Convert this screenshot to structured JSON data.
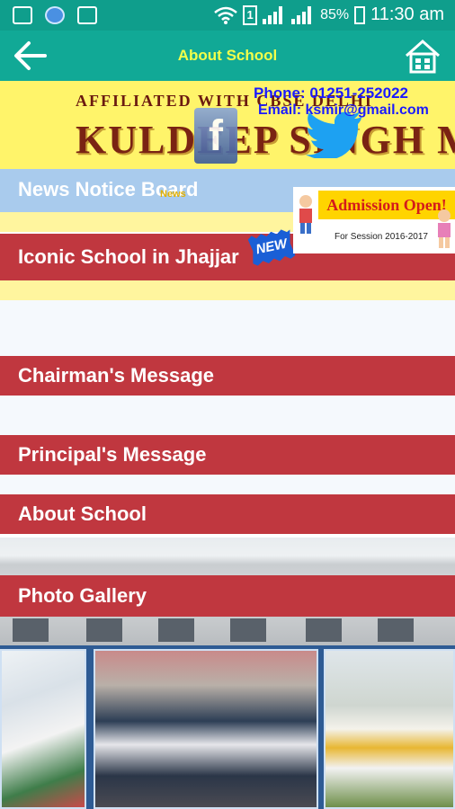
{
  "status_bar": {
    "battery": "85%",
    "time": "11:30 am",
    "battery_icon_label": "1"
  },
  "app_bar": {
    "title": "About School",
    "back_icon": "arrow-left",
    "home_icon": "home"
  },
  "banner": {
    "affiliation": "AFFILIATED WITH CBSE DELHI",
    "school_name": "KULDEEP SINGH MEMORIAL",
    "phone": "Phone: 01251-252022",
    "email": "Email: ksmir@gmail.com"
  },
  "news": {
    "label": "News Notice Board",
    "small_word": "News"
  },
  "admission_ad": {
    "title": "Admission Open!",
    "subtitle": "For Session 2016-2017"
  },
  "new_badge": "NEW",
  "menu": [
    {
      "label": "Iconic School in Jhajjar"
    },
    {
      "label": "Chairman's Message"
    },
    {
      "label": "Principal's Message"
    },
    {
      "label": "About School"
    },
    {
      "label": "Photo Gallery"
    }
  ],
  "colors": {
    "status_bar": "#0f9e8c",
    "app_bar": "#11a996",
    "title_text": "#f2ff4a",
    "menu_red": "#c0373f",
    "banner_yellow": "#fff46a",
    "news_blue": "#a9cbed"
  }
}
